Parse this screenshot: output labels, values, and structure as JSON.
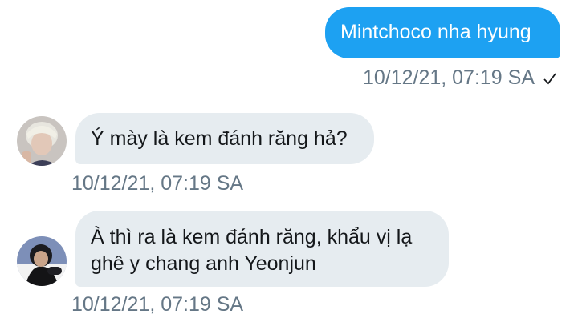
{
  "messages": [
    {
      "direction": "outgoing",
      "text": "Mintchoco nha hyung",
      "timestamp": "10/12/21, 07:19 SA",
      "status_icon": "check-icon"
    },
    {
      "direction": "incoming",
      "avatar": "avatar-blond",
      "text": "Ý mày là kem đánh răng hả?",
      "timestamp": "10/12/21, 07:19 SA"
    },
    {
      "direction": "incoming",
      "avatar": "avatar-dark-hair",
      "text_lines": [
        "À thì ra là kem đánh răng, khẩu vị lạ",
        "ghê y chang anh Yeonjun"
      ],
      "timestamp": "10/12/21, 07:19 SA"
    }
  ],
  "colors": {
    "outgoing_bubble": "#1da1f2",
    "incoming_bubble": "#e6ecf0",
    "meta_text": "#657786"
  }
}
